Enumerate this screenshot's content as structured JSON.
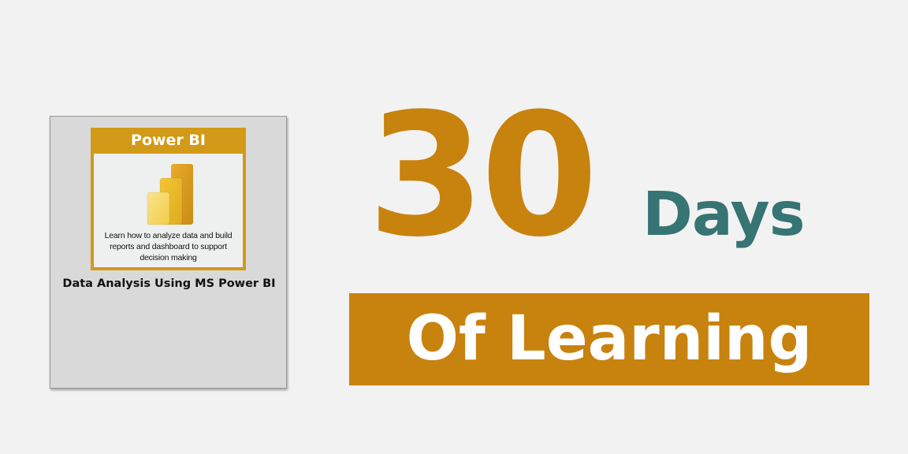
{
  "card": {
    "tile_title": "Power BI",
    "tile_description": "Learn how to analyze data and build reports and dashboard to support decision making",
    "course_title": "Data Analysis Using MS Power BI",
    "icon": "power-bi-logo-icon"
  },
  "headline": {
    "number": "30",
    "unit": "Days",
    "banner": "Of Learning"
  },
  "colors": {
    "background": "#f2f2f2",
    "accent_gold": "#c8820e",
    "tile_gold": "#d39a17",
    "teal": "#377474"
  }
}
